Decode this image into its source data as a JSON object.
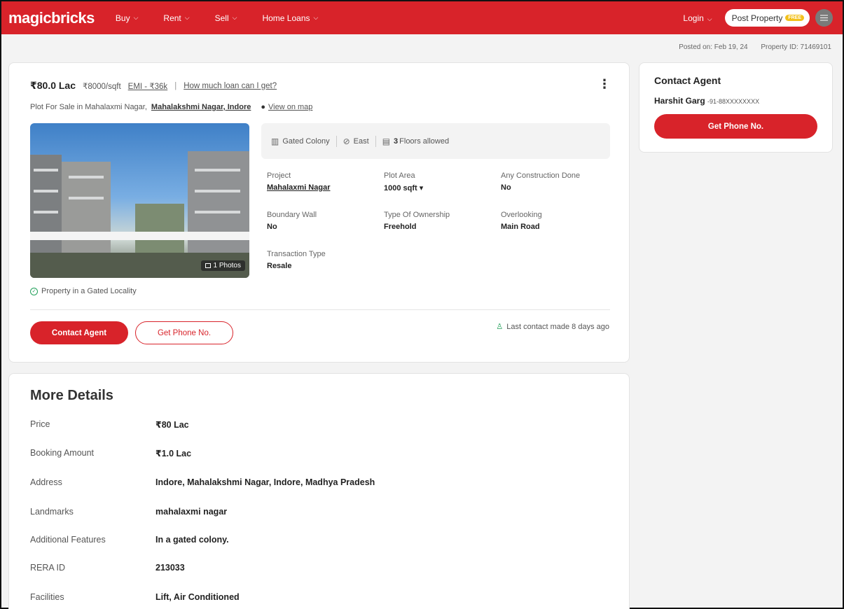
{
  "header": {
    "logo": "magicbricks",
    "nav": [
      "Buy",
      "Rent",
      "Sell",
      "Home Loans"
    ],
    "login": "Login",
    "post_property": "Post Property",
    "free_badge": "FREE",
    "brand_color": "#d8232a"
  },
  "meta": {
    "posted_on": "Posted on: Feb 19, 24",
    "property_id": "Property ID: 71469101"
  },
  "listing": {
    "price": "₹80.0 Lac",
    "price_per_sqft": "₹8000/sqft",
    "emi": "EMI - ₹36k",
    "loan_link": "How much loan can I get?",
    "location_prefix": "Plot For Sale in Mahalaxmi Nagar,",
    "location_link": "Mahalakshmi Nagar, Indore",
    "map_link": "View on map",
    "photo_count": "1 Photos",
    "chips": {
      "gated": "Gated Colony",
      "facing": "East",
      "floors_num": "3",
      "floors_text": "Floors allowed"
    },
    "attributes": {
      "project_label": "Project",
      "project_value": "Mahalaxmi Nagar",
      "plot_area_label": "Plot Area",
      "plot_area_value": "1000 sqft ▾",
      "construction_label": "Any Construction Done",
      "construction_value": "No",
      "boundary_label": "Boundary Wall",
      "boundary_value": "No",
      "ownership_label": "Type Of Ownership",
      "ownership_value": "Freehold",
      "overlooking_label": "Overlooking",
      "overlooking_value": "Main Road",
      "transaction_label": "Transaction Type",
      "transaction_value": "Resale"
    },
    "gated_note": "Property in a Gated Locality",
    "contact_button": "Contact Agent",
    "phone_button": "Get Phone No.",
    "last_contact": "Last contact made 8 days ago"
  },
  "agent": {
    "title": "Contact Agent",
    "name": "Harshit Garg",
    "phone": "-91-88XXXXXXXX",
    "button": "Get Phone No."
  },
  "details": {
    "title": "More Details",
    "rows": [
      {
        "label": "Price",
        "value": "₹80 Lac"
      },
      {
        "label": "Booking Amount",
        "value": "₹1.0 Lac"
      },
      {
        "label": "Address",
        "value": "Indore, Mahalakshmi Nagar, Indore, Madhya Pradesh"
      },
      {
        "label": "Landmarks",
        "value": "mahalaxmi nagar"
      },
      {
        "label": "Additional Features",
        "value": "In a gated colony."
      },
      {
        "label": "RERA ID",
        "value": "213033"
      },
      {
        "label": "Facilities",
        "value": "Lift, Air Conditioned"
      }
    ]
  }
}
